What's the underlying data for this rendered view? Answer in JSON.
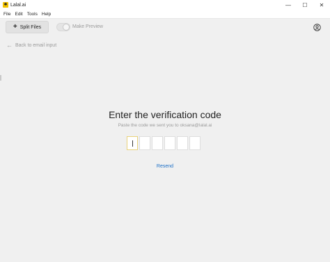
{
  "window": {
    "title": "Lalal.ai",
    "app_icon": "lalal-logo-icon",
    "controls": {
      "minimize": "—",
      "maximize": "☐",
      "close": "✕"
    }
  },
  "menu": {
    "items": [
      "File",
      "Edit",
      "Tools",
      "Help"
    ]
  },
  "toolbar": {
    "split_files_label": "Split Files",
    "make_preview_label": "Make Preview",
    "make_preview_on": false,
    "account_icon": "user-circle-icon"
  },
  "nav": {
    "back_label": "Back to email input"
  },
  "verification": {
    "heading": "Enter the verification code",
    "subtext": "Paste the code we sent you to oksana@lalal.ai",
    "code_length": 6,
    "resend_label": "Resend"
  },
  "colors": {
    "accent_link": "#1b6fc6",
    "active_box_border": "#e8d27a",
    "logo": "#f2c200"
  }
}
